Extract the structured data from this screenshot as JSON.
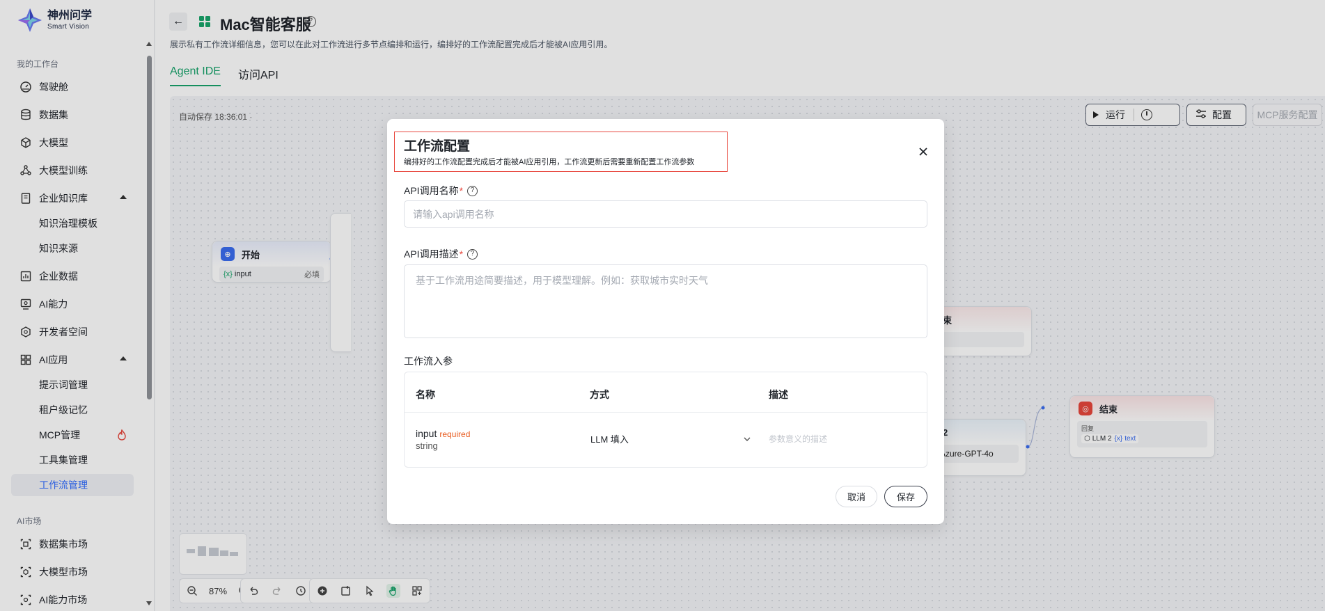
{
  "brand": {
    "name_cn": "神州问学",
    "name_en": "Smart Vision"
  },
  "sidebar": {
    "section_workspace": "我的工作台",
    "items": [
      {
        "label": "驾驶舱",
        "icon": "dashboard-icon"
      },
      {
        "label": "数据集",
        "icon": "database-icon"
      },
      {
        "label": "大模型",
        "icon": "cube-icon"
      },
      {
        "label": "大模型训练",
        "icon": "training-icon"
      },
      {
        "label": "企业知识库",
        "icon": "book-icon"
      },
      {
        "label": "企业数据",
        "icon": "chart-icon"
      },
      {
        "label": "AI能力",
        "icon": "ai-capability-icon"
      },
      {
        "label": "开发者空间",
        "icon": "developer-icon"
      },
      {
        "label": "AI应用",
        "icon": "grid-icon"
      }
    ],
    "knowledge_sub": [
      "知识治理模板",
      "知识来源"
    ],
    "app_sub": [
      "提示词管理",
      "租户级记忆",
      "MCP管理",
      "工具集管理",
      "工作流管理"
    ],
    "section_market": "AI市场",
    "market_items": [
      {
        "label": "数据集市场",
        "icon": "dataset-market-icon"
      },
      {
        "label": "大模型市场",
        "icon": "model-market-icon"
      },
      {
        "label": "AI能力市场",
        "icon": "ai-market-icon"
      }
    ]
  },
  "header": {
    "title": "Mac智能客服",
    "description": "展示私有工作流详细信息，您可以在此对工作流进行多节点编排和运行，编排好的工作流配置完成后才能被AI应用引用。",
    "tabs": [
      "Agent IDE",
      "访问API"
    ]
  },
  "canvas": {
    "autosave": "自动保存 18:36:01 ·",
    "toolbar": {
      "run": "运行",
      "config": "配置",
      "mcp": "MCP服务配置"
    },
    "nodes": {
      "start": {
        "title": "开始",
        "var_symbol": "{x}",
        "var": "input",
        "required": "必填"
      },
      "end_partial": {
        "title": "束"
      },
      "llm_partial": {
        "title": "2",
        "model": "Azure-GPT-4o"
      },
      "end": {
        "title": "结束",
        "label": "回复",
        "ref_node": "LLM 2",
        "ref_symbol": "{x}",
        "ref_var": "text"
      }
    },
    "zoom": "87%"
  },
  "modal": {
    "title": "工作流配置",
    "subtitle": "编排好的工作流配置完成后才能被AI应用引用，工作流更新后需要重新配置工作流参数",
    "api_name_label": "API调用名称",
    "api_name_placeholder": "请输入api调用名称",
    "api_desc_label": "API调用描述",
    "api_desc_placeholder": "基于工作流用途简要描述，用于模型理解。例如：获取城市实时天气",
    "required_mark": "*",
    "help_mark": "?",
    "params_label": "工作流入参",
    "columns": [
      "名称",
      "方式",
      "描述"
    ],
    "params": [
      {
        "name": "input",
        "required": "required",
        "type": "string",
        "mode": "LLM 填入",
        "desc_placeholder": "参数意义的描述"
      }
    ],
    "cancel": "取消",
    "save": "保存"
  }
}
